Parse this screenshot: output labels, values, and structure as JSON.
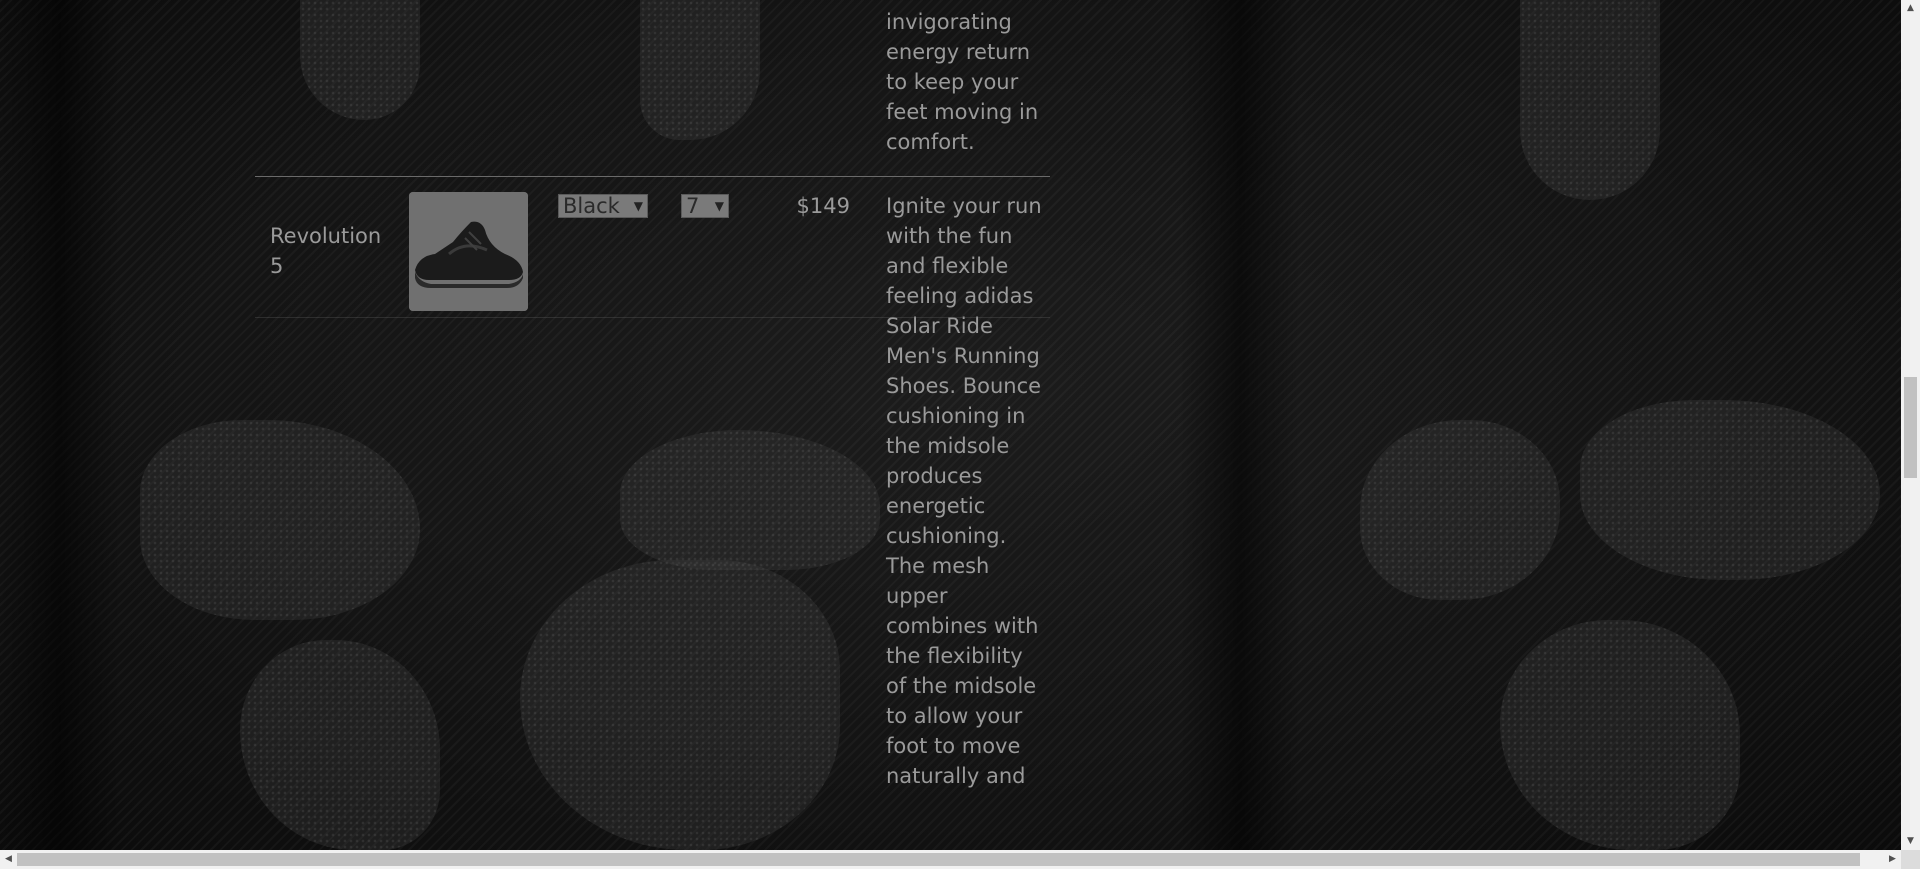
{
  "top_row": {
    "description_tail": "the invigorating energy return to keep your feet moving in comfort."
  },
  "product_row": {
    "name": "Revolution 5",
    "image_alt": "shoe-image",
    "color_select": {
      "selected": "Black"
    },
    "size_select": {
      "selected": "7"
    },
    "price": "$149",
    "description": "Ignite your run with the fun and flexible feeling adidas Solar Ride Men's Running Shoes. Bounce cushioning in the midsole produces energetic cushioning. The mesh upper combines with the flexibility of the midsole to allow your foot to move naturally and"
  },
  "scrollbar": {
    "up_icon": "triangle-up-icon",
    "down_icon": "triangle-down-icon",
    "left_icon": "triangle-left-icon",
    "right_icon": "triangle-right-icon"
  }
}
